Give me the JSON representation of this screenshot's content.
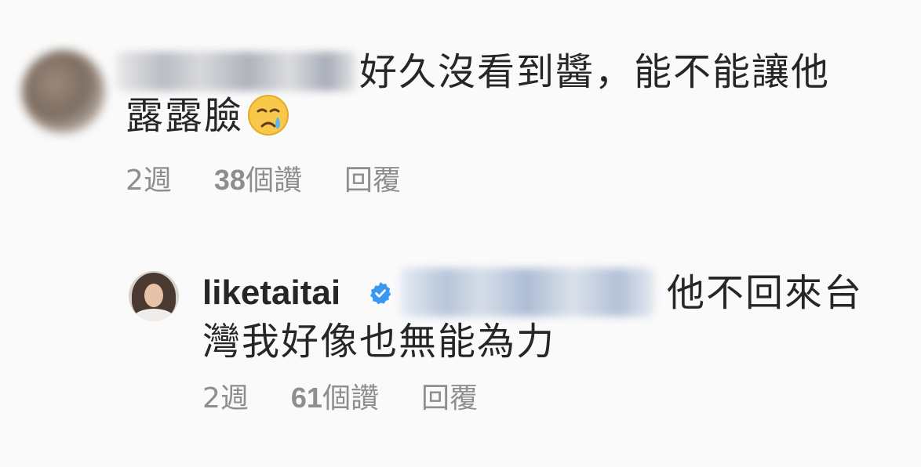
{
  "comment1": {
    "text_line_1": "好久沒看到醬，能不能讓他",
    "text_line_2": "露露臉",
    "emoji": "crying-face",
    "time": "2週",
    "likes_count": "38",
    "likes_suffix": "個讚",
    "reply_label": "回覆"
  },
  "comment2": {
    "username": "liketaitai",
    "verified": true,
    "text_line_1": "他不回來台",
    "text_line_2": "灣我好像也無能為力",
    "time": "2週",
    "likes_count": "61",
    "likes_suffix": "個讚",
    "reply_label": "回覆"
  },
  "colors": {
    "text": "#262626",
    "meta": "#8e8e8e",
    "verified_blue": "#3897f0",
    "background": "#fafafa"
  }
}
